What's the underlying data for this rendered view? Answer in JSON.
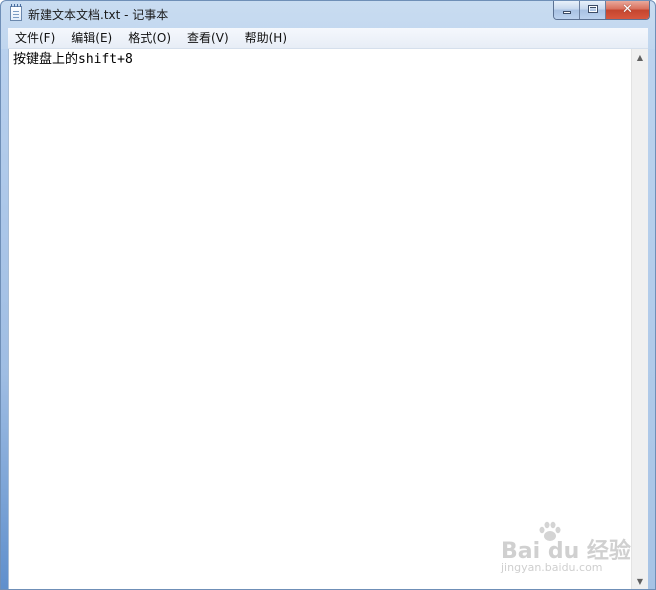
{
  "window": {
    "title": "新建文本文档.txt - 记事本",
    "close_symbol": "✕"
  },
  "menu": {
    "items": [
      {
        "label": "文件(F)"
      },
      {
        "label": "编辑(E)"
      },
      {
        "label": "格式(O)"
      },
      {
        "label": "查看(V)"
      },
      {
        "label": "帮助(H)"
      }
    ]
  },
  "editor": {
    "text": "按键盘上的shift+8"
  },
  "scrollbar": {
    "up_symbol": "▲",
    "down_symbol": "▼"
  },
  "watermark": {
    "brand": "Bai du 经验",
    "url": "jingyan.baidu.com"
  },
  "icons": {
    "app": "notepad-icon",
    "minimize": "minimize-icon",
    "maximize": "maximize-icon",
    "close": "close-icon",
    "watermark": "paw-icon"
  },
  "colors": {
    "title_bar": "#b7d0ec",
    "close_button": "#c4452e",
    "editor_background": "#ffffff"
  }
}
